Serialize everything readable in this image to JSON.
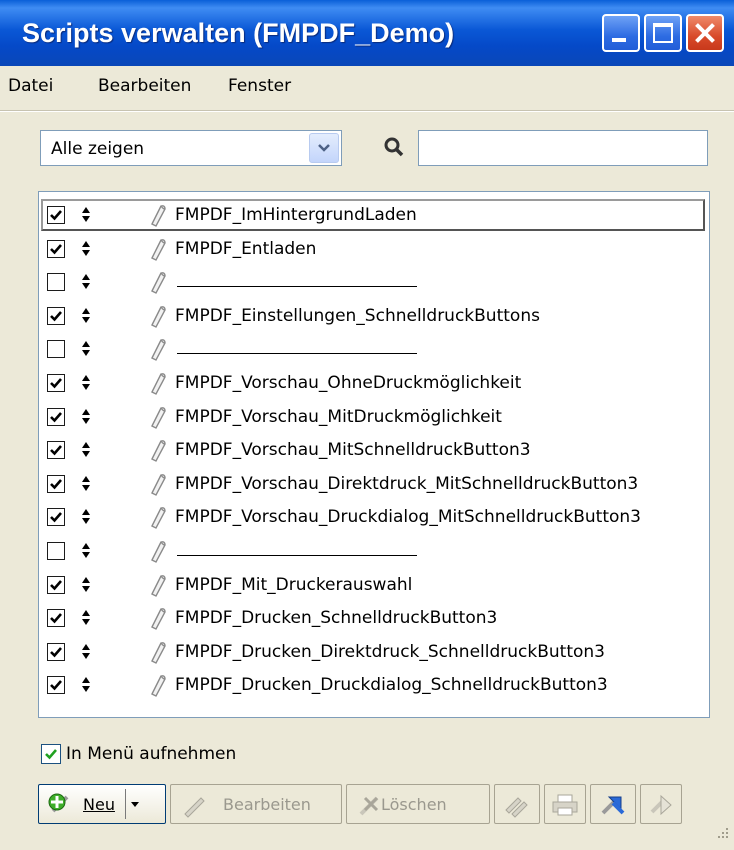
{
  "window": {
    "title": "Scripts verwalten (FMPDF_Demo)",
    "accent": "#0a58d6",
    "close_color": "#d84a2a"
  },
  "menubar": {
    "items": [
      "Datei",
      "Bearbeiten",
      "Fenster"
    ]
  },
  "filter": {
    "selected": "Alle zeigen",
    "search_icon": "search-icon",
    "search_value": ""
  },
  "scripts": [
    {
      "name": "FMPDF_ImHintergrundLaden",
      "checked": true,
      "separator": false,
      "selected": true
    },
    {
      "name": "FMPDF_Entladen",
      "checked": true,
      "separator": false
    },
    {
      "name": "",
      "checked": false,
      "separator": true
    },
    {
      "name": "FMPDF_Einstellungen_SchnelldruckButtons",
      "checked": true,
      "separator": false
    },
    {
      "name": "",
      "checked": false,
      "separator": true
    },
    {
      "name": "FMPDF_Vorschau_OhneDruckmöglichkeit",
      "checked": true,
      "separator": false
    },
    {
      "name": "FMPDF_Vorschau_MitDruckmöglichkeit",
      "checked": true,
      "separator": false
    },
    {
      "name": "FMPDF_Vorschau_MitSchnelldruckButton3",
      "checked": true,
      "separator": false
    },
    {
      "name": "FMPDF_Vorschau_Direktdruck_MitSchnelldruckButton3",
      "checked": true,
      "separator": false
    },
    {
      "name": "FMPDF_Vorschau_Druckdialog_MitSchnelldruckButton3",
      "checked": true,
      "separator": false
    },
    {
      "name": "",
      "checked": false,
      "separator": true
    },
    {
      "name": "FMPDF_Mit_Druckerauswahl",
      "checked": true,
      "separator": false
    },
    {
      "name": "FMPDF_Drucken_SchnelldruckButton3",
      "checked": true,
      "separator": false
    },
    {
      "name": "FMPDF_Drucken_Direktdruck_SchnelldruckButton3",
      "checked": true,
      "separator": false
    },
    {
      "name": "FMPDF_Drucken_Druckdialog_SchnelldruckButton3",
      "checked": true,
      "separator": false
    }
  ],
  "include_in_menu": {
    "label": "In Menü aufnehmen",
    "checked": true
  },
  "toolbar": {
    "new_label": "Neu",
    "edit_label": "Bearbeiten",
    "delete_label": "Löschen"
  }
}
